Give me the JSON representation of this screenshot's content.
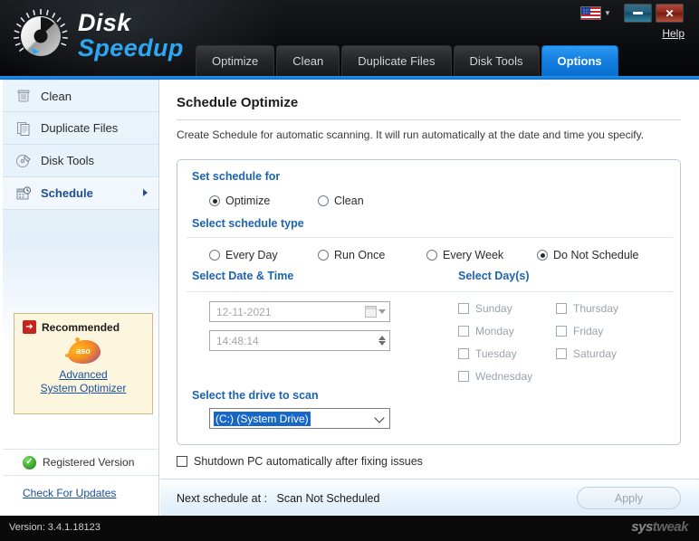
{
  "app": {
    "brand_line1": "Disk",
    "brand_line2": "Speedup",
    "logo_icon": "speedometer-icon",
    "help_label": "Help",
    "flag_icon": "us-flag-icon",
    "minimize_label": "",
    "close_label": "✕",
    "version_text": "Version: 3.4.1.18123",
    "watermark_a": "sys",
    "watermark_b": "tweak",
    "accent_blue": "#1380e2",
    "link_blue": "#1a4fa0",
    "section_blue": "#1c63b0"
  },
  "tabs": [
    {
      "label": "Optimize",
      "active": false
    },
    {
      "label": "Clean",
      "active": false
    },
    {
      "label": "Duplicate Files",
      "active": false
    },
    {
      "label": "Disk Tools",
      "active": false
    },
    {
      "label": "Options",
      "active": true
    }
  ],
  "sidebar": {
    "items": [
      {
        "label": "Clean",
        "icon": "trash-bin-icon",
        "active": false
      },
      {
        "label": "Duplicate Files",
        "icon": "documents-icon",
        "active": false
      },
      {
        "label": "Disk Tools",
        "icon": "disk-tools-icon",
        "active": false
      },
      {
        "label": "Schedule",
        "icon": "calendar-clock-icon",
        "active": true
      }
    ],
    "promo": {
      "badge": "Recommended",
      "logo_text": "aso",
      "link_line1": "Advanced",
      "link_line2": "System Optimizer"
    },
    "registered_label": "Registered Version",
    "updates_label": "Check For Updates"
  },
  "main": {
    "title": "Schedule Optimize",
    "subtitle": "Create Schedule for automatic scanning. It will run automatically at the date and time you specify.",
    "set_schedule_for_label": "Set schedule for",
    "schedule_for_options": [
      {
        "label": "Optimize",
        "selected": true
      },
      {
        "label": "Clean",
        "selected": false
      }
    ],
    "select_schedule_type_label": "Select schedule type",
    "schedule_type_options": [
      {
        "label": "Every Day",
        "selected": false
      },
      {
        "label": "Run Once",
        "selected": false
      },
      {
        "label": "Every Week",
        "selected": false
      },
      {
        "label": "Do Not Schedule",
        "selected": true
      }
    ],
    "select_date_time_label": "Select Date & Time",
    "date_value": "12-11-2021",
    "time_value": "14:48:14",
    "select_days_label": "Select Day(s)",
    "days_col1": [
      {
        "label": "Sunday",
        "checked": false
      },
      {
        "label": "Monday",
        "checked": false
      },
      {
        "label": "Tuesday",
        "checked": false
      },
      {
        "label": "Wednesday",
        "checked": false
      }
    ],
    "days_col2": [
      {
        "label": "Thursday",
        "checked": false
      },
      {
        "label": "Friday",
        "checked": false
      },
      {
        "label": "Saturday",
        "checked": false
      }
    ],
    "select_drive_label": "Select the drive to scan",
    "drive_value": "(C:)  (System Drive)",
    "shutdown_label": "Shutdown PC automatically after fixing issues",
    "shutdown_checked": false,
    "next_schedule_label": "Next schedule at :",
    "next_schedule_value": "Scan Not Scheduled",
    "apply_label": "Apply"
  }
}
